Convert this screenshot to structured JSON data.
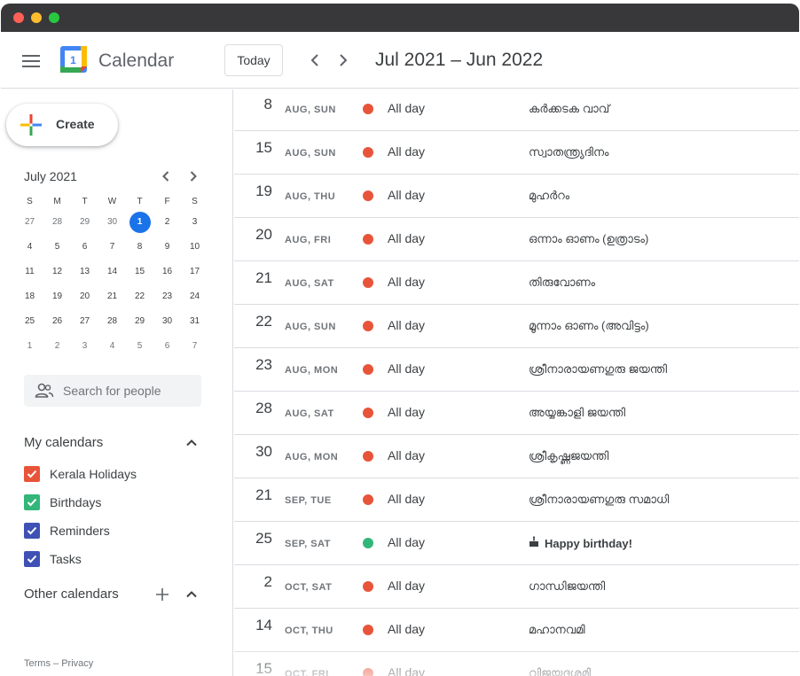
{
  "header": {
    "app_title": "Calendar",
    "logo_text": "1",
    "today_label": "Today",
    "date_range": "Jul 2021 – Jun 2022"
  },
  "sidebar": {
    "create_label": "Create",
    "mini_calendar": {
      "title": "July 2021",
      "weekdays": [
        "S",
        "M",
        "T",
        "W",
        "T",
        "F",
        "S"
      ],
      "weeks": [
        [
          "27",
          "28",
          "29",
          "30",
          "1",
          "2",
          "3"
        ],
        [
          "4",
          "5",
          "6",
          "7",
          "8",
          "9",
          "10"
        ],
        [
          "11",
          "12",
          "13",
          "14",
          "15",
          "16",
          "17"
        ],
        [
          "18",
          "19",
          "20",
          "21",
          "22",
          "23",
          "24"
        ],
        [
          "25",
          "26",
          "27",
          "28",
          "29",
          "30",
          "31"
        ],
        [
          "1",
          "2",
          "3",
          "4",
          "5",
          "6",
          "7"
        ]
      ],
      "today": "1"
    },
    "search_placeholder": "Search for people",
    "my_calendars_label": "My calendars",
    "my_calendars": [
      {
        "label": "Kerala Holidays",
        "color": "#e8543a"
      },
      {
        "label": "Birthdays",
        "color": "#33b679"
      },
      {
        "label": "Reminders",
        "color": "#3f51b5"
      },
      {
        "label": "Tasks",
        "color": "#3f51b5"
      }
    ],
    "other_calendars_label": "Other calendars",
    "terms_label": "Terms",
    "footer_separator": "–",
    "privacy_label": "Privacy"
  },
  "events": [
    {
      "day": "8",
      "date": "AUG, SUN",
      "time": "All day",
      "title": "കർക്കടക വാവ്",
      "color": "#e8543a"
    },
    {
      "day": "15",
      "date": "AUG, SUN",
      "time": "All day",
      "title": "സ്വാതന്ത്ര്യദിനം",
      "color": "#e8543a"
    },
    {
      "day": "19",
      "date": "AUG, THU",
      "time": "All day",
      "title": "മുഹർറം",
      "color": "#e8543a"
    },
    {
      "day": "20",
      "date": "AUG, FRI",
      "time": "All day",
      "title": "ഒന്നാം ഓണം (ഉത്രാടം)",
      "color": "#e8543a"
    },
    {
      "day": "21",
      "date": "AUG, SAT",
      "time": "All day",
      "title": "തിരുവോണം",
      "color": "#e8543a"
    },
    {
      "day": "22",
      "date": "AUG, SUN",
      "time": "All day",
      "title": "മൂന്നാം ഓണം (അവിട്ടം)",
      "color": "#e8543a"
    },
    {
      "day": "23",
      "date": "AUG, MON",
      "time": "All day",
      "title": "ശ്രീനാരായണഗുരു ജയന്തി",
      "color": "#e8543a"
    },
    {
      "day": "28",
      "date": "AUG, SAT",
      "time": "All day",
      "title": "അയ്യങ്കാളി ജയന്തി",
      "color": "#e8543a"
    },
    {
      "day": "30",
      "date": "AUG, MON",
      "time": "All day",
      "title": "ശ്രീകൃഷ്ണജയന്തി",
      "color": "#e8543a"
    },
    {
      "day": "21",
      "date": "SEP, TUE",
      "time": "All day",
      "title": "ശ്രീനാരായണഗുരു സമാധി",
      "color": "#e8543a"
    },
    {
      "day": "25",
      "date": "SEP, SAT",
      "time": "All day",
      "title": "Happy birthday!",
      "color": "#33b679",
      "birthday": true
    },
    {
      "day": "2",
      "date": "OCT, SAT",
      "time": "All day",
      "title": "ഗാന്ധിജയന്തി",
      "color": "#e8543a"
    },
    {
      "day": "14",
      "date": "OCT, THU",
      "time": "All day",
      "title": "മഹാനവമി",
      "color": "#e8543a"
    },
    {
      "day": "15",
      "date": "OCT, FRI",
      "time": "All day",
      "title": "വിജയദശമി",
      "color": "#e8543a"
    }
  ]
}
